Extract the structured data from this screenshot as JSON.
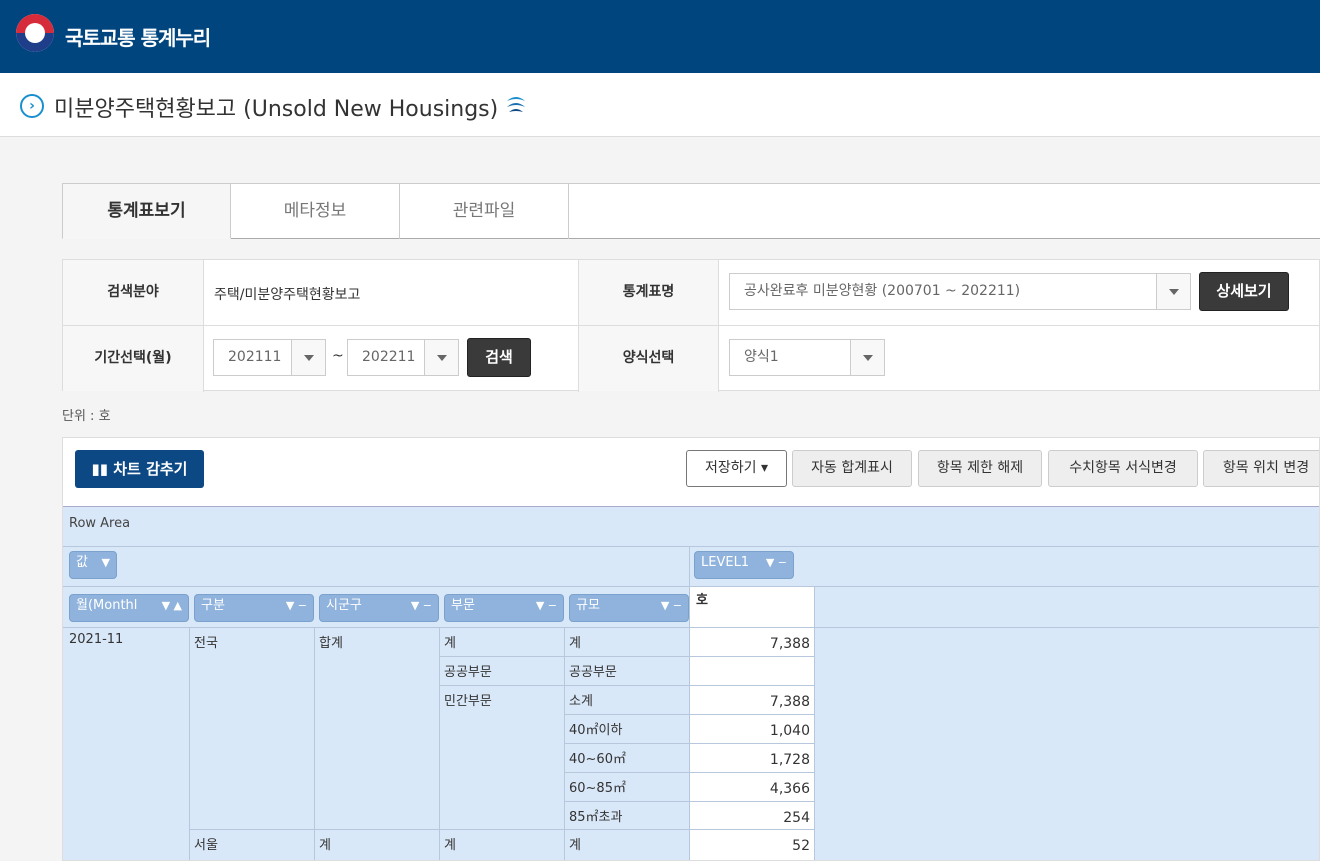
{
  "header": {
    "brand": "국토교통 통계누리"
  },
  "page": {
    "title": "미분양주택현황보고 (Unsold New Housings)"
  },
  "tabs": [
    "통계표보기",
    "메타정보",
    "관련파일"
  ],
  "search": {
    "field_label": "검색분야",
    "field_value": "주택/미분양주택현황보고",
    "table_label": "통계표명",
    "table_value": "공사완료후 미분양현황 (200701 ~ 202211)",
    "detail_button": "상세보기",
    "period_label": "기간선택(월)",
    "period_from": "202111",
    "period_sep": "~",
    "period_to": "202211",
    "search_button": "검색",
    "format_label": "양식선택",
    "format_value": "양식1"
  },
  "unit_text": "단위 : 호",
  "toolbar": {
    "chart_toggle": "차트 감추기",
    "save": "저장하기",
    "auto_sum": "자동 합계표시",
    "release_limit": "항목 제한 해제",
    "num_format": "수치항목 서식변경",
    "move_item": "항목 위치 변경"
  },
  "pivot": {
    "row_area": "Row Area",
    "value_chip": "값",
    "col_chip": "LEVEL1",
    "row_chips": [
      "월(Monthl",
      "구분",
      "시군구",
      "부문",
      "규모"
    ],
    "value_header": "호",
    "rows": [
      {
        "month": "2021-11",
        "region": "전국",
        "sigungu": "합계",
        "sector": "계",
        "size": "계",
        "value": "7,388"
      },
      {
        "month": "",
        "region": "",
        "sigungu": "",
        "sector": "공공부문",
        "size": "공공부문",
        "value": ""
      },
      {
        "month": "",
        "region": "",
        "sigungu": "",
        "sector": "민간부문",
        "size": "소계",
        "value": "7,388"
      },
      {
        "month": "",
        "region": "",
        "sigungu": "",
        "sector": "",
        "size": "40㎡이하",
        "value": "1,040"
      },
      {
        "month": "",
        "region": "",
        "sigungu": "",
        "sector": "",
        "size": "40~60㎡",
        "value": "1,728"
      },
      {
        "month": "",
        "region": "",
        "sigungu": "",
        "sector": "",
        "size": "60~85㎡",
        "value": "4,366"
      },
      {
        "month": "",
        "region": "",
        "sigungu": "",
        "sector": "",
        "size": "85㎡초과",
        "value": "254"
      },
      {
        "month": "",
        "region": "서울",
        "sigungu": "계",
        "sector": "계",
        "size": "계",
        "value": "52"
      }
    ]
  }
}
